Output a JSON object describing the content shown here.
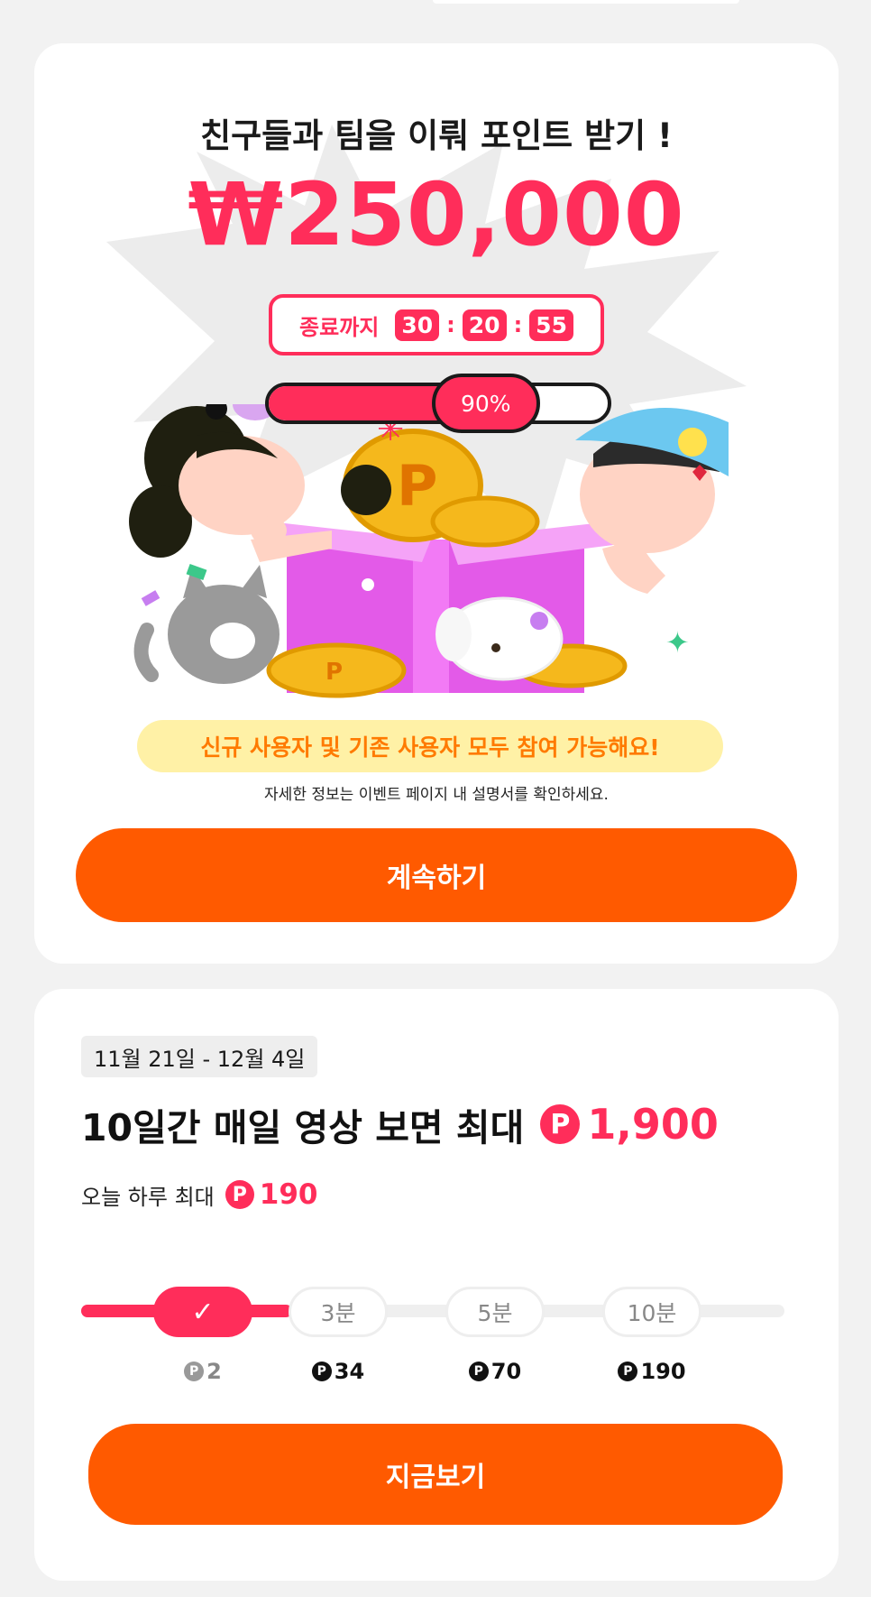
{
  "promo": {
    "headline": "친구들과 팀을 이뤄 포인트 받기 !",
    "amount": "₩250,000",
    "timer": {
      "label": "종료까지",
      "hours": "30",
      "minutes": "20",
      "seconds": "55",
      "separator": ":"
    },
    "progress": {
      "percent": 90,
      "label": "90%"
    },
    "banner": "신규 사용자 및 기존 사용자 모두 참여 가능해요!",
    "info": "자세한 정보는 이벤트 페이지 내 설명서를 확인하세요.",
    "continue_label": "계속하기",
    "colors": {
      "accent": "#ff2d5a",
      "button": "#ff5a00",
      "banner_bg": "#fff1a6",
      "banner_text": "#ff7a00"
    }
  },
  "video": {
    "date_range": "11월 21일 - 12월 4일",
    "title": "10일간 매일 영상 보면 최대",
    "coin_symbol": "P",
    "max_points": "1,900",
    "today_label": "오늘 하루 최대",
    "today_points": "190",
    "done_mark": "✓",
    "steps": [
      {
        "label": "",
        "reward": "2",
        "done": true
      },
      {
        "label": "3분",
        "reward": "34",
        "done": false
      },
      {
        "label": "5분",
        "reward": "70",
        "done": false
      },
      {
        "label": "10분",
        "reward": "190",
        "done": false
      }
    ],
    "watch_label": "지금보기"
  }
}
